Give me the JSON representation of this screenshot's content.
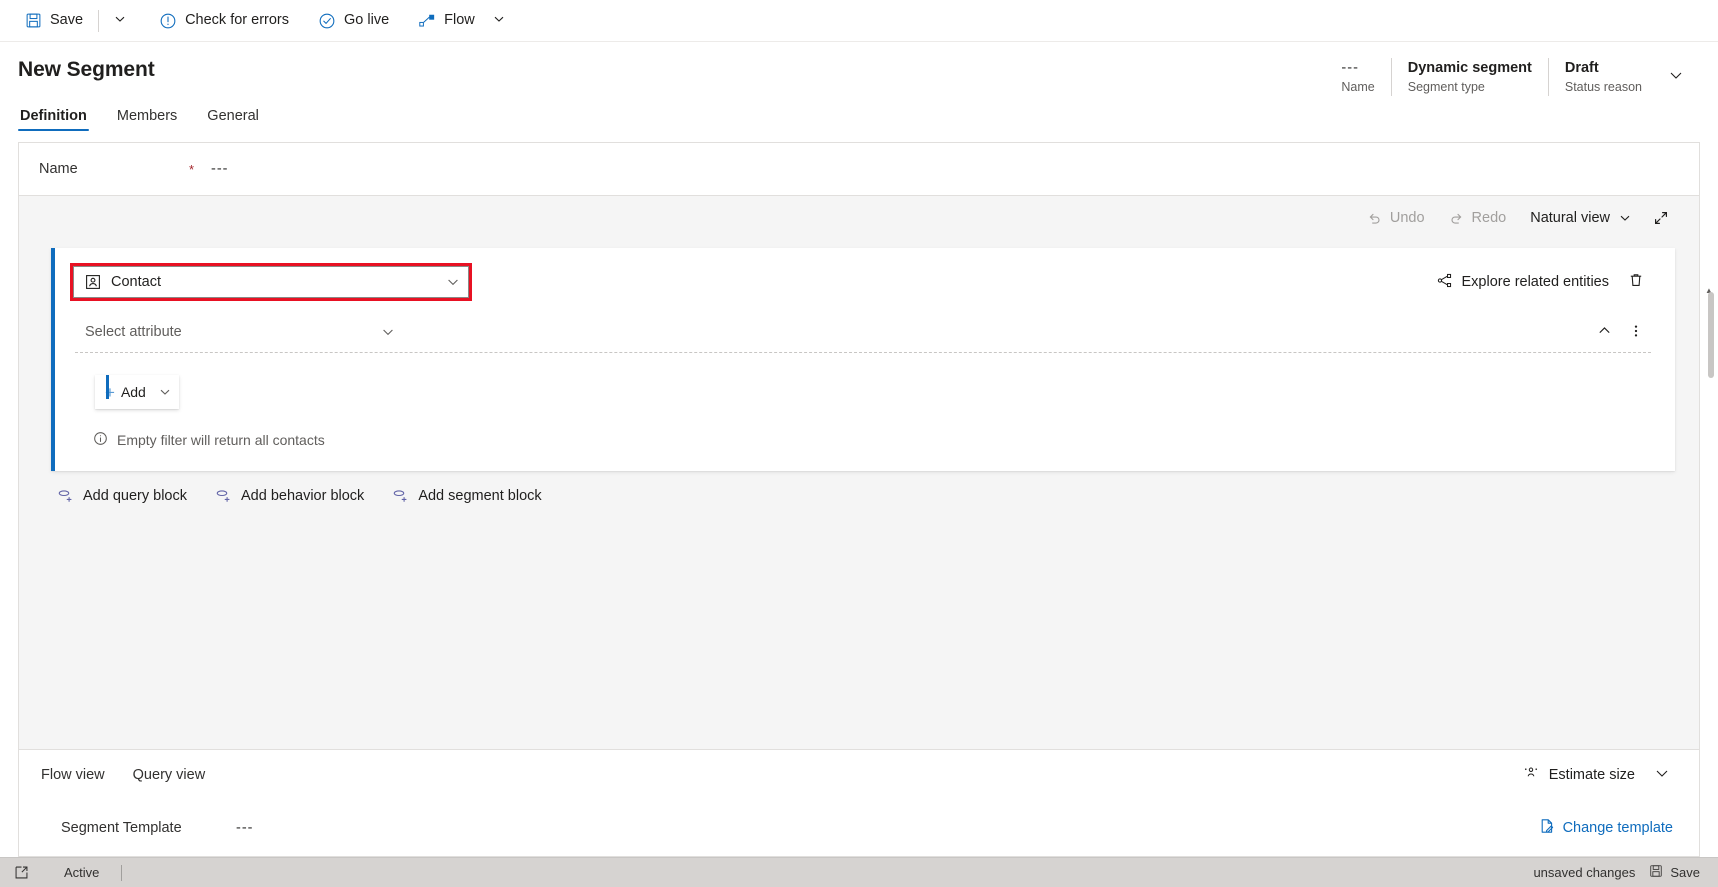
{
  "commandbar": {
    "save_label": "Save",
    "save_icon": "save-disk-icon",
    "save_caret_icon": "chevron-down-icon",
    "check_errors_label": "Check for errors",
    "check_errors_icon": "exclamation-circle-icon",
    "go_live_label": "Go live",
    "go_live_icon": "check-circle-icon",
    "flow_label": "Flow",
    "flow_icon": "flow-node-icon",
    "flow_caret_icon": "chevron-down-icon"
  },
  "header": {
    "title": "New Segment",
    "meta": [
      {
        "value": "---",
        "label": "Name",
        "dim": true
      },
      {
        "value": "Dynamic segment",
        "label": "Segment type",
        "dim": false
      },
      {
        "value": "Draft",
        "label": "Status reason",
        "dim": false
      }
    ],
    "chevron_icon": "chevron-down-icon"
  },
  "tabs": [
    {
      "label": "Definition",
      "active": true
    },
    {
      "label": "Members",
      "active": false
    },
    {
      "label": "General",
      "active": false
    }
  ],
  "form": {
    "name_label": "Name",
    "name_required": "*",
    "name_value": "---"
  },
  "builder": {
    "toolbar": {
      "undo_label": "Undo",
      "undo_icon": "undo-arrow-icon",
      "redo_label": "Redo",
      "redo_icon": "redo-arrow-icon",
      "view_label": "Natural view",
      "view_caret_icon": "chevron-down-icon",
      "expand_icon": "expand-diagonal-icon"
    },
    "entity": {
      "value": "Contact",
      "icon": "contact-entity-icon",
      "caret_icon": "chevron-down-icon",
      "highlight_color": "#e81123"
    },
    "explore_label": "Explore related entities",
    "explore_icon": "share-nodes-icon",
    "delete_icon": "trash-icon",
    "attribute": {
      "placeholder": "Select attribute",
      "caret_icon": "chevron-down-icon",
      "collapse_icon": "chevron-up-icon",
      "more_icon": "more-vertical-icon"
    },
    "add": {
      "label": "Add",
      "plus_icon": "plus-icon",
      "caret_icon": "chevron-down-icon"
    },
    "empty_note": "Empty filter will return all contacts",
    "empty_note_icon": "info-circle-icon",
    "block_links": [
      {
        "label": "Add query block",
        "icon": "add-query-block-icon"
      },
      {
        "label": "Add behavior block",
        "icon": "add-behavior-block-icon"
      },
      {
        "label": "Add segment block",
        "icon": "add-segment-block-icon"
      }
    ]
  },
  "footer": {
    "views": [
      {
        "label": "Flow view"
      },
      {
        "label": "Query view"
      }
    ],
    "estimate_label": "Estimate size",
    "estimate_icon": "people-estimate-icon",
    "estimate_caret_icon": "chevron-down-icon",
    "template_label": "Segment Template",
    "template_value": "---",
    "change_template_label": "Change template",
    "change_template_icon": "page-edit-icon"
  },
  "statusbar": {
    "popout_icon": "pop-out-icon",
    "state_label": "Active",
    "unsaved_label": "unsaved changes",
    "save_label": "Save",
    "save_icon": "save-disk-icon"
  }
}
